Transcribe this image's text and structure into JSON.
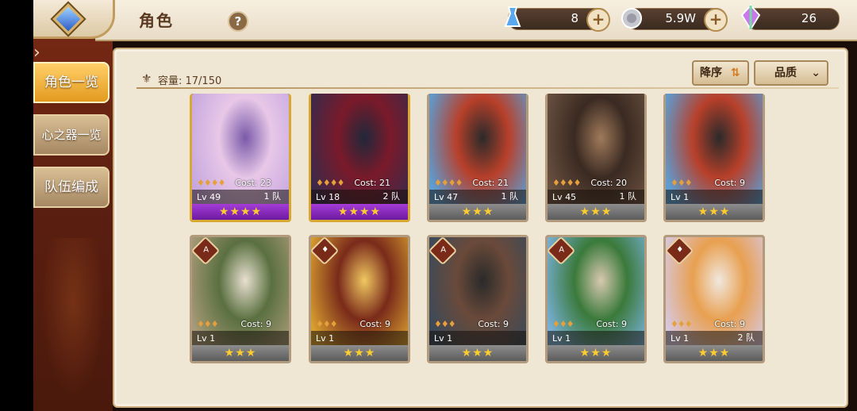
{
  "header": {
    "title": "角色",
    "help_label": "?"
  },
  "resources": [
    {
      "icon": "potion-icon",
      "value": "8"
    },
    {
      "icon": "coin-icon",
      "value": "5.9W"
    },
    {
      "icon": "crystal-icon",
      "value": "26"
    }
  ],
  "menu": {
    "items": [
      {
        "label": "角色一览",
        "active": true
      },
      {
        "label": "心之器一览",
        "active": false
      },
      {
        "label": "队伍编成",
        "active": false
      }
    ]
  },
  "capacity": {
    "label": "容量: 17/150"
  },
  "sort": {
    "order_label": "降序",
    "filter_label": "品质"
  },
  "cards": [
    {
      "lv": "Lv 49",
      "cost": "Cost: 23",
      "team": "1 队",
      "stars": "★★★★",
      "rarity": "gold",
      "pips": "♦♦♦♦",
      "elem": "",
      "palette": [
        "#c6a7de",
        "#e8c7e8",
        "#7a5aa8"
      ]
    },
    {
      "lv": "Lv 18",
      "cost": "Cost: 21",
      "team": "2 队",
      "stars": "★★★★",
      "rarity": "gold",
      "pips": "♦♦♦♦",
      "elem": "",
      "palette": [
        "#3a2a4a",
        "#7a1a2a",
        "#20283a"
      ]
    },
    {
      "lv": "Lv 47",
      "cost": "Cost: 21",
      "team": "1 队",
      "stars": "★★★",
      "rarity": "silver",
      "pips": "♦♦♦♦",
      "elem": "",
      "palette": [
        "#5aa0d8",
        "#b8402a",
        "#2a2a2a"
      ]
    },
    {
      "lv": "Lv 45",
      "cost": "Cost: 20",
      "team": "1 队",
      "stars": "★★★",
      "rarity": "silver",
      "pips": "♦♦♦♦",
      "elem": "",
      "palette": [
        "#6a5040",
        "#3a2a22",
        "#a07a5a"
      ]
    },
    {
      "lv": "Lv 1",
      "cost": "Cost: 9",
      "team": "",
      "stars": "★★★",
      "rarity": "silver",
      "pips": "♦♦♦",
      "elem": "",
      "palette": [
        "#5aa0d8",
        "#b8402a",
        "#2a2a2a"
      ]
    },
    {
      "lv": "Lv 1",
      "cost": "Cost: 9",
      "team": "",
      "stars": "★★★",
      "rarity": "silver",
      "pips": "♦♦♦",
      "elem": "A",
      "palette": [
        "#a89a78",
        "#5a7040",
        "#e8e0d0"
      ]
    },
    {
      "lv": "Lv 1",
      "cost": "Cost: 9",
      "team": "",
      "stars": "★★★",
      "rarity": "silver",
      "pips": "♦♦♦",
      "elem": "♦",
      "palette": [
        "#d8a030",
        "#7a2a1a",
        "#f0c860"
      ]
    },
    {
      "lv": "Lv 1",
      "cost": "Cost: 9",
      "team": "",
      "stars": "★★★",
      "rarity": "silver",
      "pips": "♦♦♦",
      "elem": "A",
      "palette": [
        "#3a4a5a",
        "#6a4a3a",
        "#2a2a2a"
      ]
    },
    {
      "lv": "Lv 1",
      "cost": "Cost: 9",
      "team": "",
      "stars": "★★★",
      "rarity": "silver",
      "pips": "♦♦♦",
      "elem": "A",
      "palette": [
        "#7ab0d8",
        "#3a7a3a",
        "#d8c8b0"
      ]
    },
    {
      "lv": "Lv 1",
      "cost": "Cost: 9",
      "team": "2 队",
      "stars": "★★★",
      "rarity": "silver",
      "pips": "♦♦♦",
      "elem": "♦",
      "palette": [
        "#d8c8e0",
        "#e8a050",
        "#f0e8e0"
      ]
    }
  ]
}
